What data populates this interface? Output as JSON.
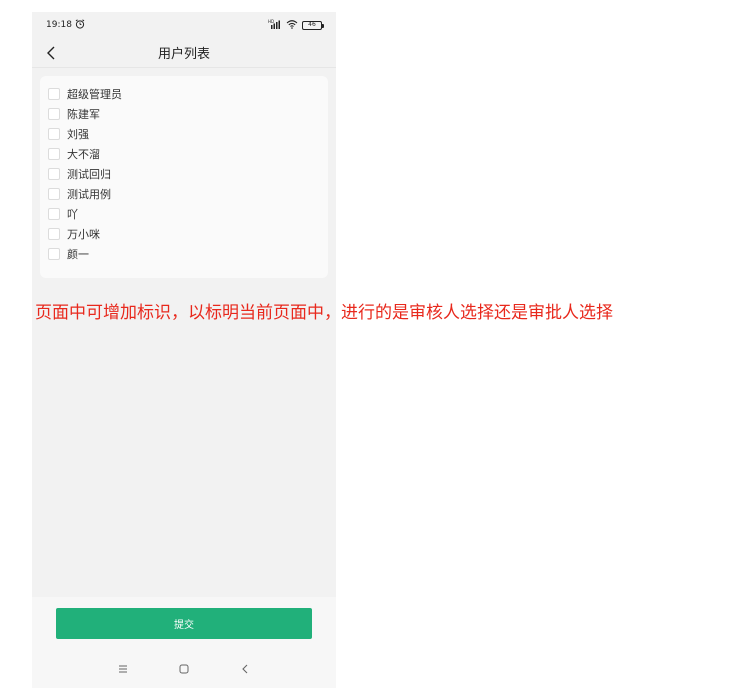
{
  "status_bar": {
    "time": "19:18",
    "alarm_icon": "alarm-clock-icon",
    "signal_label": "HD",
    "battery": "46"
  },
  "nav": {
    "back_icon": "chevron-left-icon",
    "title": "用户列表"
  },
  "users": [
    {
      "name": "超级管理员",
      "checked": false
    },
    {
      "name": "陈建军",
      "checked": false
    },
    {
      "name": "刘强",
      "checked": false
    },
    {
      "name": "大不溜",
      "checked": false
    },
    {
      "name": "测试回归",
      "checked": false
    },
    {
      "name": "测试用例",
      "checked": false
    },
    {
      "name": "吖",
      "checked": false
    },
    {
      "name": "万小咪",
      "checked": false
    },
    {
      "name": "颜一",
      "checked": false
    }
  ],
  "submit_label": "提交",
  "system_nav": {
    "menu_icon": "menu-icon",
    "home_icon": "home-square-icon",
    "back_icon": "back-triangle-icon"
  },
  "annotation": "页面中可增加标识，以标明当前页面中，进行的是审核人选择还是审批人选择",
  "colors": {
    "accent": "#21b07a",
    "annotation": "#e8281c",
    "background": "#f2f2f2"
  }
}
